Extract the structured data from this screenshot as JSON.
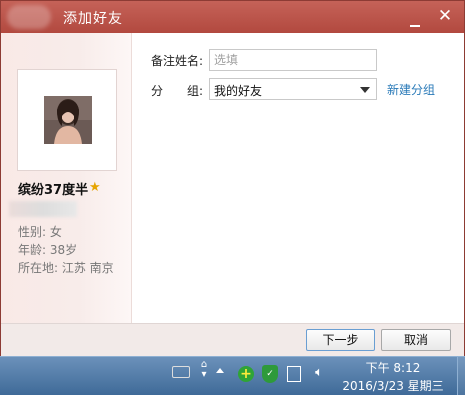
{
  "window": {
    "title": "添加好友"
  },
  "profile": {
    "nickname": "缤纷37度半",
    "gender": "性别: 女",
    "age": "年龄: 38岁",
    "location": "所在地: 江苏  南京"
  },
  "form": {
    "remark_label": "备注姓名:",
    "remark_placeholder": "选填",
    "remark_value": "",
    "group_label_left": "分",
    "group_label_right": "组:",
    "group_value": "我的好友",
    "new_group_link": "新建分组"
  },
  "buttons": {
    "next": "下一步",
    "cancel": "取消"
  },
  "taskbar": {
    "time": "下午 8:12",
    "date": "2016/3/23 星期三"
  },
  "colors": {
    "titlebar": "#b64f45",
    "link": "#2a7ab8",
    "taskbar": "#4f78a4"
  }
}
